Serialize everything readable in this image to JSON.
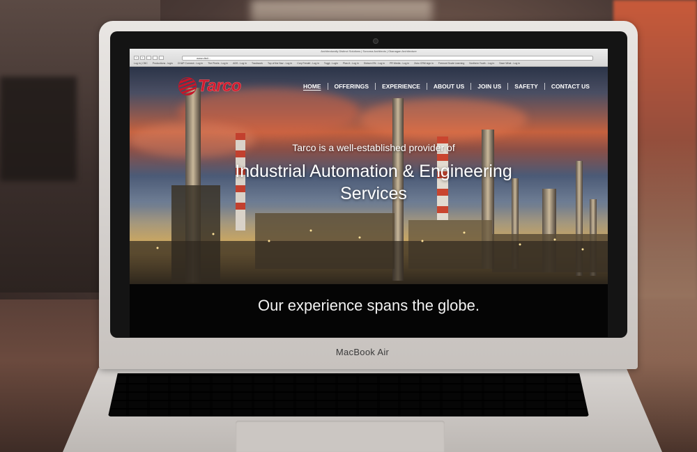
{
  "browser": {
    "window_title": "Architecturally Distinct Solutions | Sonoma Architects | Okanagan Architecture",
    "url": "www.disti...",
    "bookmarks": [
      "Log in | CBC",
      "Productions - login",
      "CHAP Connect - Log in",
      "The Pixels - Log in",
      "ADS - Log in",
      "Trackwork",
      "Top of the Nav - Log in",
      "Cory Fendel - Log in",
      "Toggl - Login",
      "Plan-It - Log in",
      "Sixburn EN - Log in",
      "PR Media - Log in",
      "Zuko CRM sign in",
      "Fremont Scale Learning",
      "Northern Youth - Log in",
      "Save What - Log in"
    ]
  },
  "site": {
    "logo_text": "Tarco",
    "nav": [
      "HOME",
      "OFFERINGS",
      "EXPERIENCE",
      "ABOUT US",
      "JOIN US",
      "SAFETY",
      "CONTACT US"
    ],
    "hero_subtitle": "Tarco is a well-established provider of",
    "hero_title_line1": "Industrial Automation & Engineering",
    "hero_title_line2": "Services",
    "band_text": "Our experience spans the globe."
  },
  "device": {
    "label": "MacBook Air"
  },
  "colors": {
    "brand_red": "#d0192e",
    "band_bg": "#050505"
  }
}
